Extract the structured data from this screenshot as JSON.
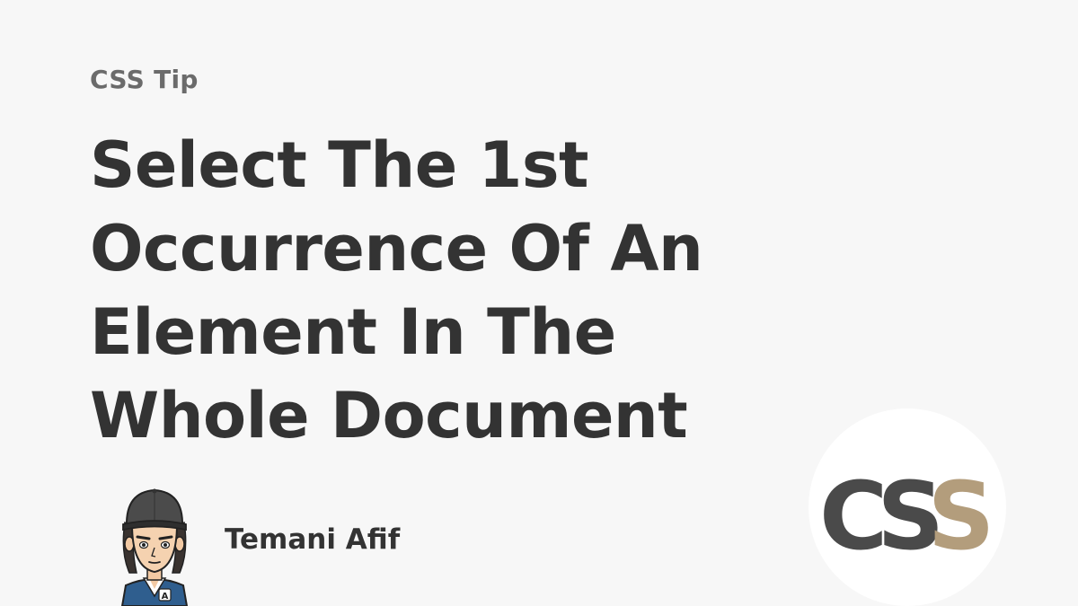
{
  "kicker": "CSS Tip",
  "title_lines": [
    "Select The 1st",
    "Occurrence Of An",
    "Element In The",
    "Whole Document"
  ],
  "author": {
    "name": "Temani Afif",
    "avatar_badge": "A"
  },
  "logo": {
    "letters": [
      "C",
      "S",
      "S"
    ],
    "colors": [
      "#4a4a4a",
      "#4a4a4a",
      "#b39d7c"
    ]
  }
}
